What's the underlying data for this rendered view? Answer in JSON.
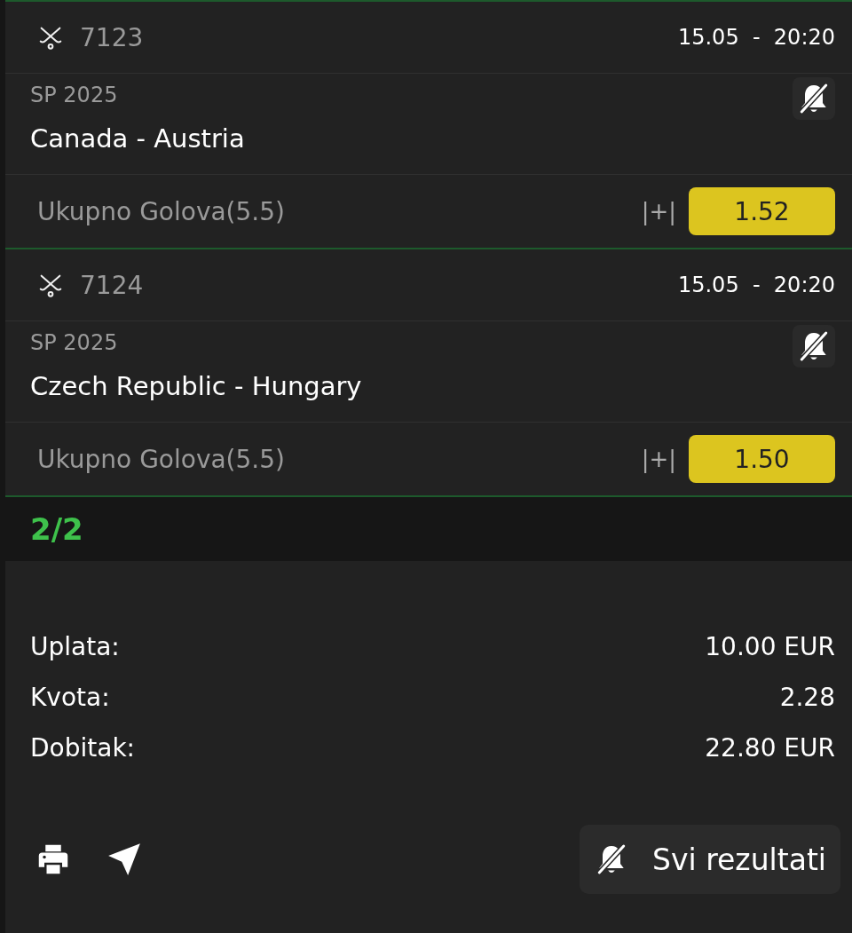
{
  "matches": [
    {
      "code": "7123",
      "datetime": "15.05  -  20:20",
      "league": "SP 2025",
      "teams": "Canada - Austria",
      "market": "Ukupno Golova(5.5)",
      "boost": "|+|",
      "odds": "1.52"
    },
    {
      "code": "7124",
      "datetime": "15.05  -  20:20",
      "league": "SP 2025",
      "teams": "Czech Republic - Hungary",
      "market": "Ukupno Golova(5.5)",
      "boost": "|+|",
      "odds": "1.50"
    }
  ],
  "count": "2/2",
  "summary": [
    {
      "label": "Uplata:",
      "value": "10.00 EUR"
    },
    {
      "label": "Kvota:",
      "value": "2.28"
    },
    {
      "label": "Dobitak:",
      "value": "22.80 EUR"
    }
  ],
  "results_button": "Svi rezultati"
}
